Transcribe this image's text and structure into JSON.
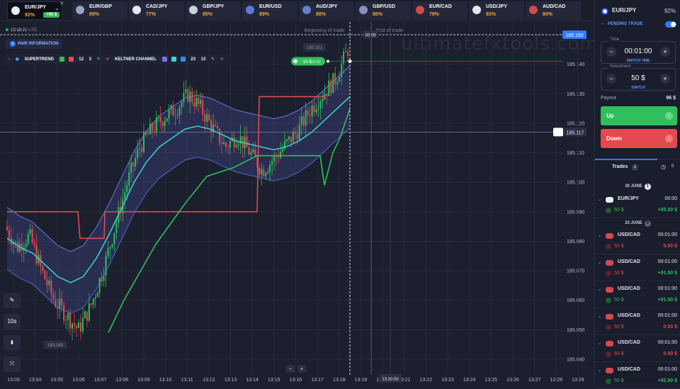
{
  "tabs": [
    {
      "pair": "EUR/JPY",
      "pct": "92%",
      "badge": "+95 $",
      "flag": "#e9edf5",
      "active": true
    },
    {
      "pair": "EUR/GBP",
      "pct": "89%",
      "flag": "#9aa3c4"
    },
    {
      "pair": "CAD/JPY",
      "pct": "77%",
      "flag": "#e6e8ef"
    },
    {
      "pair": "GBP/JPY",
      "pct": "85%",
      "flag": "#c9cfe0"
    },
    {
      "pair": "EUR/USD",
      "pct": "89%",
      "flag": "#5a7bd6"
    },
    {
      "pair": "AUD/JPY",
      "pct": "88%",
      "flag": "#6a7fcf"
    },
    {
      "pair": "GBP/USD",
      "pct": "86%",
      "flag": "#8892b6"
    },
    {
      "pair": "EUR/CAD",
      "pct": "78%",
      "flag": "#d24a4a"
    },
    {
      "pair": "USD/JPY",
      "pct": "83%",
      "flag": "#e6e8ef"
    },
    {
      "pair": "AUD/CAD",
      "pct": "80%",
      "flag": "#d24a4a"
    }
  ],
  "chart_header": {
    "time": "13:18:21",
    "tz": "UTC",
    "pair_info": "PAIR INFORMATION",
    "watermark": "ultimatefxtools.com"
  },
  "indicators": {
    "supertrend": "SUPERTREND",
    "st_a": "12",
    "st_b": "3",
    "keltner": "KELTNER CHANNEL",
    "kc_a": "23",
    "kc_b": "13"
  },
  "chart_labels": {
    "beginning": "Beginning of trade",
    "end": "End of trade",
    "countdown": "00:09",
    "top_marker": "185.151",
    "bottom_marker": "185.049",
    "trade_tag": "50 $",
    "trade_tag_time": "00:00",
    "current_price": "185.150",
    "cross_price": "185.117",
    "cross_time": "13:20:00",
    "zoom_minus": "−",
    "zoom_plus": "+"
  },
  "tools": [
    "✎",
    "10s",
    "⬍",
    "⤧"
  ],
  "chart_data": {
    "type": "candlestick",
    "y_ticks": [
      "185.150",
      "185.140",
      "185.130",
      "185.120",
      "185.110",
      "185.100",
      "185.090",
      "185.080",
      "185.070",
      "185.060",
      "185.050",
      "185.040"
    ],
    "x_ticks": [
      "13:03",
      "13:04",
      "13:05",
      "13:06",
      "13:07",
      "13:08",
      "13:09",
      "13:10",
      "13:11",
      "13:12",
      "13:13",
      "13:14",
      "13:15",
      "13:16",
      "13:17",
      "13:18",
      "13:19",
      "13:20",
      "13:21",
      "13:22",
      "13:23",
      "13:24",
      "13:25",
      "13:26",
      "13:27",
      "13:28",
      "13:29"
    ],
    "ylim": [
      185.04,
      185.15
    ],
    "price_path": [
      185.085,
      185.078,
      185.082,
      185.07,
      185.06,
      185.055,
      185.05,
      185.058,
      185.07,
      185.085,
      185.1,
      185.112,
      185.118,
      185.122,
      185.125,
      185.13,
      185.125,
      185.118,
      185.112,
      185.116,
      185.11,
      185.104,
      185.108,
      185.113,
      185.118,
      185.125,
      185.13,
      185.135,
      185.145
    ],
    "keltner_mid": [
      185.081,
      185.078,
      185.076,
      185.072,
      185.068,
      185.066,
      185.068,
      185.074,
      185.082,
      185.091,
      185.1,
      185.107,
      185.112,
      185.115,
      185.118,
      185.119,
      185.118,
      185.116,
      185.114,
      185.113,
      185.112,
      185.111,
      185.112,
      185.114,
      185.117,
      185.121,
      185.125,
      185.129
    ],
    "supertrend_red": [
      185.09,
      185.09,
      185.09,
      185.09,
      185.081,
      185.081,
      185.09,
      185.09,
      185.129,
      185.129,
      185.129,
      185.129,
      185.129
    ],
    "supertrend_green": [
      185.049,
      185.06,
      185.079,
      185.093,
      185.102,
      185.105,
      185.109,
      185.109,
      185.109,
      185.099,
      185.11,
      185.115,
      185.125
    ]
  },
  "panel": {
    "pair": "EUR/JPY",
    "pct": "92%",
    "pending": "PENDING TRADE",
    "time_label": "Time",
    "time_value": "00:01:00",
    "switch_time": "SWITCH TIME",
    "inv_label": "Investment",
    "inv_value": "50 $",
    "switch": "SWITCH",
    "payout_label": "Payout",
    "payout_value": "96 $",
    "up": "Up",
    "down": "Down",
    "trades_label": "Trades",
    "trades_count": "1",
    "history_count": "0"
  },
  "history": {
    "date1": "30 JUNE",
    "date1_count": "1",
    "date2": "23 JUNE",
    "date2_count": "9",
    "items": [
      {
        "pair": "EUR/JPY",
        "time": "00:00",
        "amount": "50 $",
        "result": "+95.00 $",
        "dir": "up",
        "flag": "#e9edf5"
      },
      {
        "pair": "USD/CAD",
        "time": "00:01:00",
        "amount": "50 $",
        "result": "0.00 $",
        "dir": "down",
        "flag": "#d24a4a"
      },
      {
        "pair": "USD/CAD",
        "time": "00:01:00",
        "amount": "50 $",
        "result": "+91.50 $",
        "dir": "down",
        "flag": "#d24a4a"
      },
      {
        "pair": "USD/CAD",
        "time": "00:01:00",
        "amount": "50 $",
        "result": "+91.50 $",
        "dir": "up",
        "flag": "#d24a4a"
      },
      {
        "pair": "USD/CAD",
        "time": "00:01:00",
        "amount": "50 $",
        "result": "0.00 $",
        "dir": "down",
        "flag": "#d24a4a"
      },
      {
        "pair": "USD/CAD",
        "time": "00:01:00",
        "amount": "50 $",
        "result": "0.00 $",
        "dir": "down",
        "flag": "#d24a4a"
      },
      {
        "pair": "USD/CAD",
        "time": "00:01:00",
        "amount": "50 $",
        "result": "+92.50 $",
        "dir": "up",
        "flag": "#d24a4a"
      }
    ]
  },
  "colors": {
    "up": "#2fbf5d",
    "down": "#e3494f",
    "accent": "#2f7bff",
    "keltner_mid": "#3fd6d0",
    "keltner_band": "#5b6bd6"
  }
}
